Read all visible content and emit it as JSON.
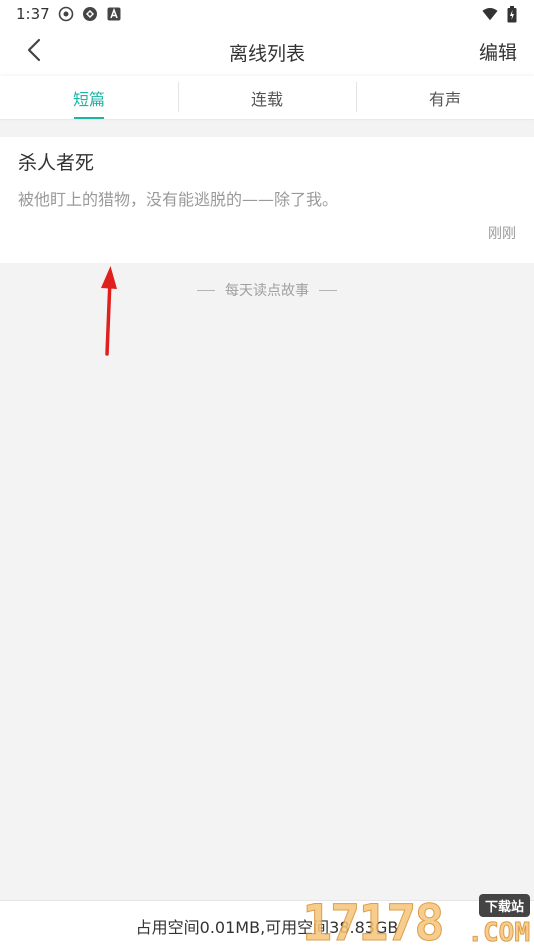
{
  "status_bar": {
    "time": "1:37",
    "left_icons": [
      "record-icon",
      "sync-icon",
      "a-badge-icon"
    ],
    "right_icons": [
      "wifi-icon",
      "battery-icon"
    ]
  },
  "header": {
    "title": "离线列表",
    "edit_label": "编辑",
    "back_icon": "chevron-left-icon"
  },
  "tabs": [
    {
      "label": "短篇",
      "active": true
    },
    {
      "label": "连载",
      "active": false
    },
    {
      "label": "有声",
      "active": false
    }
  ],
  "stories": [
    {
      "title": "杀人者死",
      "excerpt": "被他盯上的猎物，没有能逃脱的——除了我。",
      "time": "刚刚"
    }
  ],
  "slogan": "每天读点故事",
  "storage": {
    "text": "占用空间0.01MB,可用空间38.83GB"
  },
  "watermark": {
    "digits": "17178",
    "badge": "下载站",
    "suffix": ".COM"
  },
  "colors": {
    "accent": "#1cb5a3",
    "annotation": "#e0201c"
  }
}
